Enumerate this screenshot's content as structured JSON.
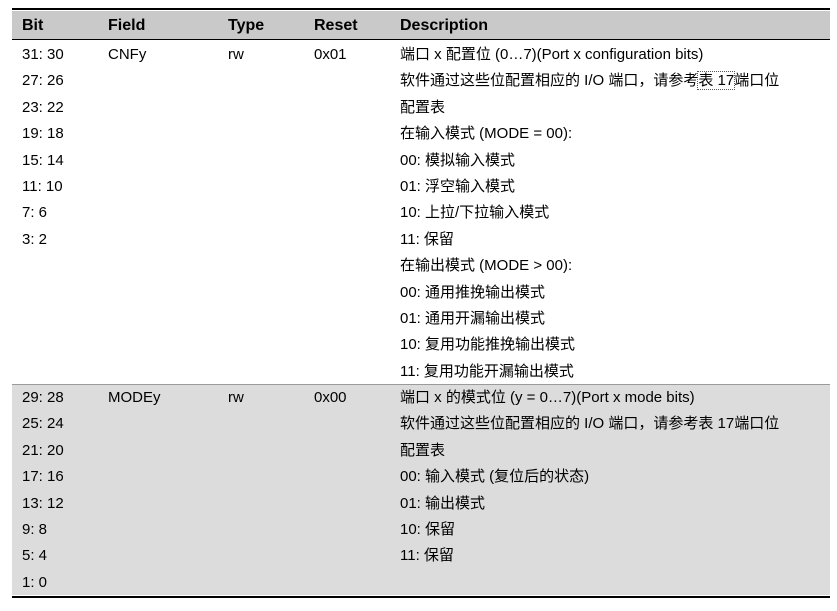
{
  "headers": {
    "bit": "Bit",
    "field": "Field",
    "type": "Type",
    "reset": "Reset",
    "description": "Description"
  },
  "rows": [
    {
      "bits": [
        "31: 30",
        "27: 26",
        "23: 22",
        "19: 18",
        "15: 14",
        "11: 10",
        "7: 6",
        "3: 2"
      ],
      "field": "CNFy",
      "type": "rw",
      "reset": "0x01",
      "description": [
        "端口 x 配置位 (0…7)(Port x configuration bits)",
        "软件通过这些位配置相应的 I/O 端口，请参考",
        "配置表",
        "在输入模式 (MODE = 00):",
        "00: 模拟输入模式",
        "01: 浮空输入模式",
        "10: 上拉/下拉输入模式",
        "11: 保留",
        "在输出模式 (MODE > 00):",
        "00: 通用推挽输出模式",
        "01: 通用开漏输出模式",
        "10: 复用功能推挽输出模式",
        "11: 复用功能开漏输出模式"
      ],
      "desc_ref": "表 17",
      "desc_after_ref": "端口位"
    },
    {
      "bits": [
        "29: 28",
        "25: 24",
        "21: 20",
        "17: 16",
        "13: 12",
        "9: 8",
        "5: 4",
        "1: 0"
      ],
      "field": "MODEy",
      "type": "rw",
      "reset": "0x00",
      "description": [
        "端口 x 的模式位 (y = 0…7)(Port x mode bits)",
        "软件通过这些位配置相应的 I/O 端口，请参考表 17端口位",
        "配置表",
        "00: 输入模式 (复位后的状态)",
        "01: 输出模式",
        "10: 保留",
        "11: 保留"
      ]
    }
  ],
  "colors": {
    "header_bg": "#c9c9c9",
    "row_alt_bg": "#dcdcdc",
    "rule": "#000000"
  }
}
